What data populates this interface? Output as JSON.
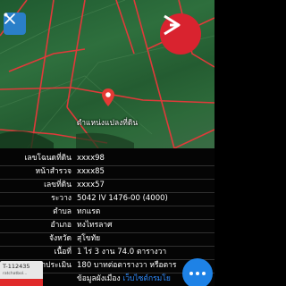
{
  "map": {
    "pin_label": "ตำแหน่งแปลงที่ดิน"
  },
  "details": [
    {
      "label": "เลขโฉนดที่ดิน",
      "value": "xxxx98"
    },
    {
      "label": "หน้าสำรวจ",
      "value": "xxxx85"
    },
    {
      "label": "เลขที่ดิน",
      "value": "xxxx57"
    },
    {
      "label": "ระวาง",
      "value": "5042 IV 1476-00 (4000)"
    },
    {
      "label": "ตำบล",
      "value": "ทกแรต"
    },
    {
      "label": "อำเภอ",
      "value": "ทงไทรลาศ"
    },
    {
      "label": "จังหวัด",
      "value": "สุโขทัย"
    },
    {
      "label": "เนื้อที่",
      "value": "1 ไร่ 3 งาน 74.0 ตารางวา"
    },
    {
      "label": "ราคาประเมิน",
      "value": "180 บาทต่อตารางวา หรือตาร"
    },
    {
      "label": "",
      "value": "ข้อมูลผังเมือง",
      "link": "เว็บไซต์กรมโย"
    }
  ],
  "tag": {
    "id": "T-112435",
    "small": "ratchatbol..."
  },
  "colors": {
    "boundary": "#e03a3a",
    "accent": "#1e82e6",
    "brand": "#d9232f"
  },
  "icons": {
    "map_tool": "crossed-tools-icon",
    "brand": "brand-logo-icon",
    "pin": "location-pin-icon",
    "fab": "more-icon"
  }
}
